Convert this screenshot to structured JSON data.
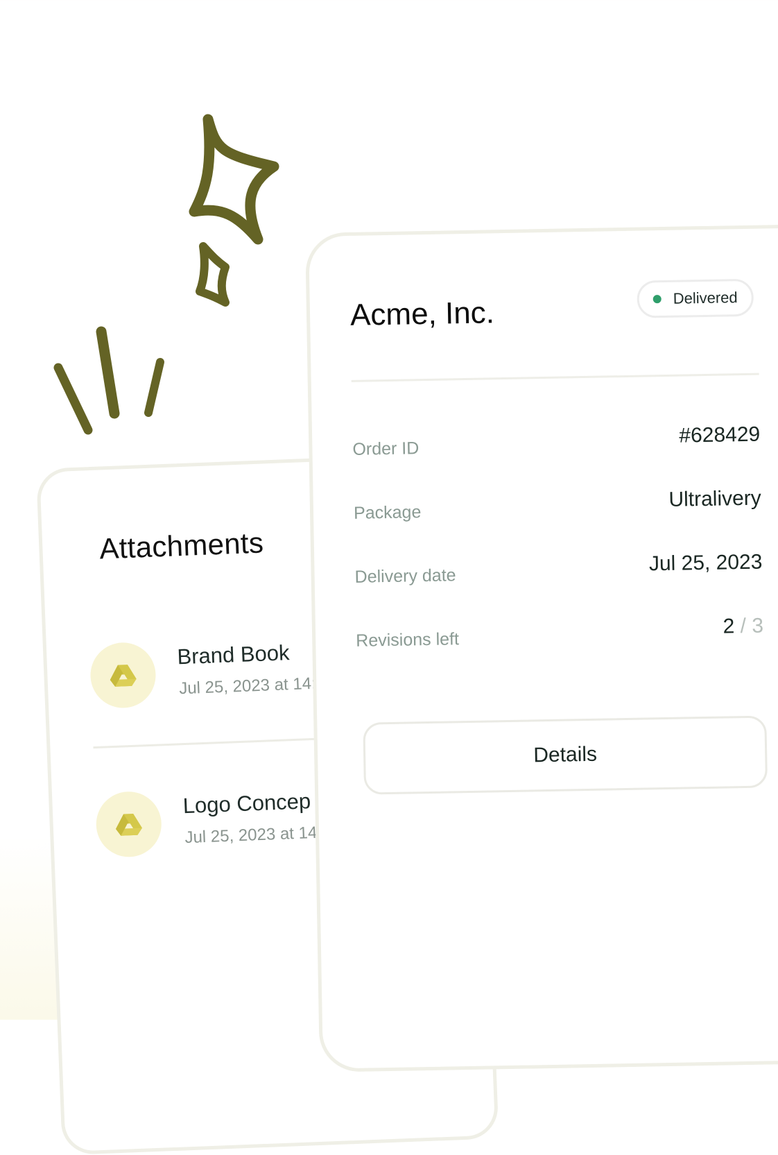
{
  "colors": {
    "doodle": "#646325",
    "drive_icon": "#d4c84a",
    "file_bubble": "#f8f4d3",
    "status_dot": "#2f9e6b",
    "card_border": "#efefe6"
  },
  "attachments": {
    "title": "Attachments",
    "items": [
      {
        "name": "Brand Book",
        "meta": "Jul 25, 2023 at 14:",
        "icon": "google-drive-icon"
      },
      {
        "name": "Logo Concep",
        "meta": "Jul 25, 2023 at 14",
        "icon": "google-drive-icon"
      }
    ]
  },
  "order": {
    "company": "Acme, Inc.",
    "status": "Delivered",
    "rows": [
      {
        "label": "Order ID",
        "value": "#628429"
      },
      {
        "label": "Package",
        "value": "Ultralivery"
      },
      {
        "label": "Delivery date",
        "value": "Jul 25, 2023"
      },
      {
        "label": "Revisions left",
        "value_used": "2",
        "value_sep": "/",
        "value_total": "3"
      }
    ],
    "button_label": "Details"
  }
}
